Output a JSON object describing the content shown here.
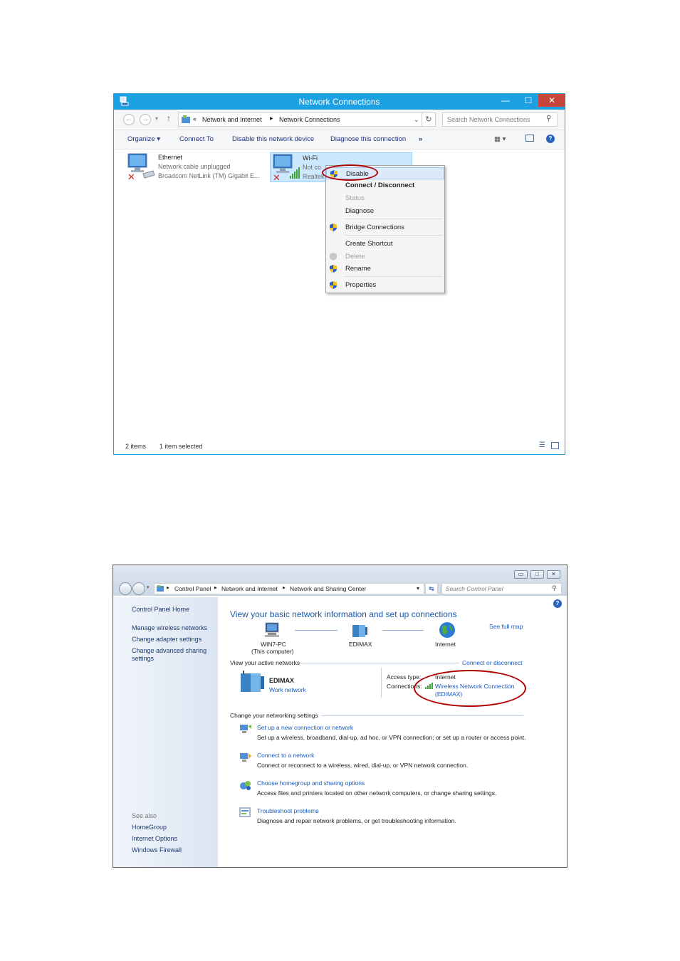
{
  "window1": {
    "title": "Network Connections",
    "window_buttons": {
      "minimize": "—",
      "maximize": "☐",
      "close": "✕"
    },
    "address": {
      "chevrons": "«",
      "crumbs": [
        "Network and Internet",
        "Network Connections"
      ],
      "search_placeholder": "Search Network Connections"
    },
    "toolbar": {
      "organize": "Organize",
      "connect_to": "Connect To",
      "disable_device": "Disable this network device",
      "diagnose": "Diagnose this connection",
      "more": "»"
    },
    "connections": [
      {
        "name": "Ethernet",
        "status": "Network cable unplugged",
        "adapter": "Broadcom NetLink (TM) Gigabit E..."
      },
      {
        "name": "Wi-Fi",
        "status": "Not co",
        "adapter": "Realtek"
      }
    ],
    "context_menu": [
      {
        "label": "Disable",
        "shield": true,
        "disabled": false,
        "bold": false
      },
      {
        "label": "Connect / Disconnect",
        "shield": false,
        "disabled": false,
        "bold": true
      },
      {
        "label": "Status",
        "shield": false,
        "disabled": true,
        "bold": false
      },
      {
        "label": "Diagnose",
        "shield": false,
        "disabled": false,
        "bold": false
      },
      {
        "label": "Bridge Connections",
        "shield": true,
        "disabled": false,
        "bold": false
      },
      {
        "label": "Create Shortcut",
        "shield": false,
        "disabled": false,
        "bold": false
      },
      {
        "label": "Delete",
        "shield": true,
        "disabled": true,
        "bold": false
      },
      {
        "label": "Rename",
        "shield": true,
        "disabled": false,
        "bold": false
      },
      {
        "label": "Properties",
        "shield": true,
        "disabled": false,
        "bold": false
      }
    ],
    "statusbar": {
      "items": "2 items",
      "selected": "1 item selected"
    },
    "colors": {
      "titlebar": "#1ba1e2",
      "close": "#c7463c",
      "highlight_ring": "#b00000"
    }
  },
  "window2": {
    "address": {
      "crumbs": [
        "Control Panel",
        "Network and Internet",
        "Network and Sharing Center"
      ],
      "search_placeholder": "Search Control Panel"
    },
    "sidebar": {
      "home": "Control Panel Home",
      "links": [
        "Manage wireless networks",
        "Change adapter settings",
        "Change advanced sharing",
        "settings"
      ],
      "see_also_label": "See also",
      "see_also": [
        "HomeGroup",
        "Internet Options",
        "Windows Firewall"
      ]
    },
    "main": {
      "heading": "View your basic network information and set up connections",
      "see_full_map": "See full map",
      "map": {
        "computer": "WIN7-PC",
        "computer_note": "(This computer)",
        "network": "EDIMAX",
        "internet": "Internet"
      },
      "active_networks_label": "View your active networks",
      "connect_or_disconnect": "Connect or disconnect",
      "active": {
        "name": "EDIMAX",
        "type": "Work network",
        "access_type_label": "Access type:",
        "access_type": "Internet",
        "connections_label": "Connections:",
        "connection_line1": "Wireless Network Connection",
        "connection_line2": "(EDIMAX)"
      },
      "change_settings_label": "Change your networking settings",
      "tasks": [
        {
          "title": "Set up a new connection or network",
          "desc": "Set up a wireless, broadband, dial-up, ad hoc, or VPN connection; or set up a router or access point."
        },
        {
          "title": "Connect to a network",
          "desc": "Connect or reconnect to a wireless, wired, dial-up, or VPN network connection."
        },
        {
          "title": "Choose homegroup and sharing options",
          "desc": "Access files and printers located on other network computers, or change sharing settings."
        },
        {
          "title": "Troubleshoot problems",
          "desc": "Diagnose and repair network problems, or get troubleshooting information."
        }
      ]
    }
  }
}
